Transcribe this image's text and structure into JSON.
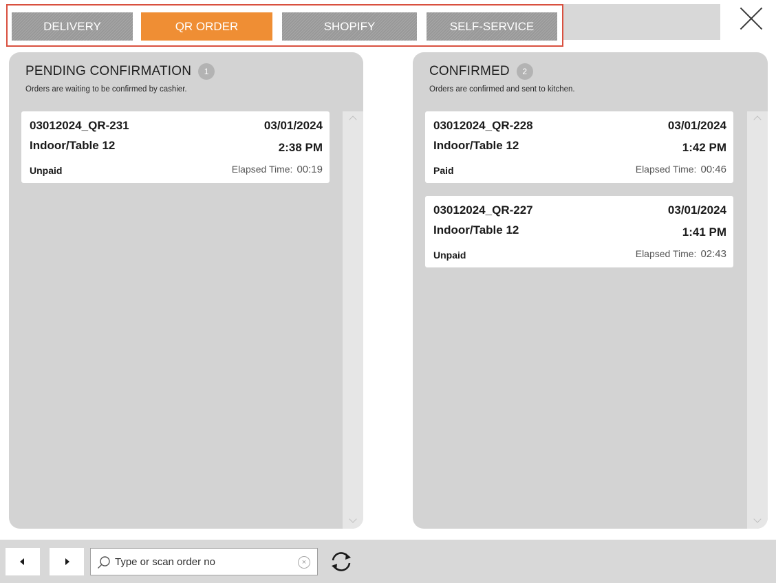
{
  "tabs": [
    {
      "label": "DELIVERY",
      "active": false
    },
    {
      "label": "QR ORDER",
      "active": true
    },
    {
      "label": "SHOPIFY",
      "active": false
    },
    {
      "label": "SELF-SERVICE",
      "active": false
    }
  ],
  "colors": {
    "active_tab": "#ef8e34",
    "inactive_tab": "#9e9e9e",
    "highlight_border": "#d9503f",
    "panel_bg": "#d3d3d3"
  },
  "pending": {
    "title": "PENDING CONFIRMATION",
    "count": "1",
    "subtitle": "Orders are waiting to be confirmed by cashier.",
    "orders": [
      {
        "order_no": "03012024_QR-231",
        "date": "03/01/2024",
        "table": "Indoor/Table 12",
        "time": "2:38 PM",
        "status": "Unpaid",
        "elapsed_label": "Elapsed Time:",
        "elapsed": "00:19"
      }
    ]
  },
  "confirmed": {
    "title": "CONFIRMED",
    "count": "2",
    "subtitle": "Orders are confirmed and sent to kitchen.",
    "orders": [
      {
        "order_no": "03012024_QR-228",
        "date": "03/01/2024",
        "table": "Indoor/Table 12",
        "time": "1:42 PM",
        "status": "Paid",
        "elapsed_label": "Elapsed Time:",
        "elapsed": "00:46"
      },
      {
        "order_no": "03012024_QR-227",
        "date": "03/01/2024",
        "table": "Indoor/Table 12",
        "time": "1:41 PM",
        "status": "Unpaid",
        "elapsed_label": "Elapsed Time:",
        "elapsed": "02:43"
      }
    ]
  },
  "search": {
    "placeholder": "Type or scan order no",
    "value": ""
  },
  "icons": {
    "close": "close-icon",
    "search": "search-icon",
    "clear": "clear-icon",
    "refresh": "refresh-icon",
    "prev": "caret-left-icon",
    "next": "caret-right-icon"
  }
}
